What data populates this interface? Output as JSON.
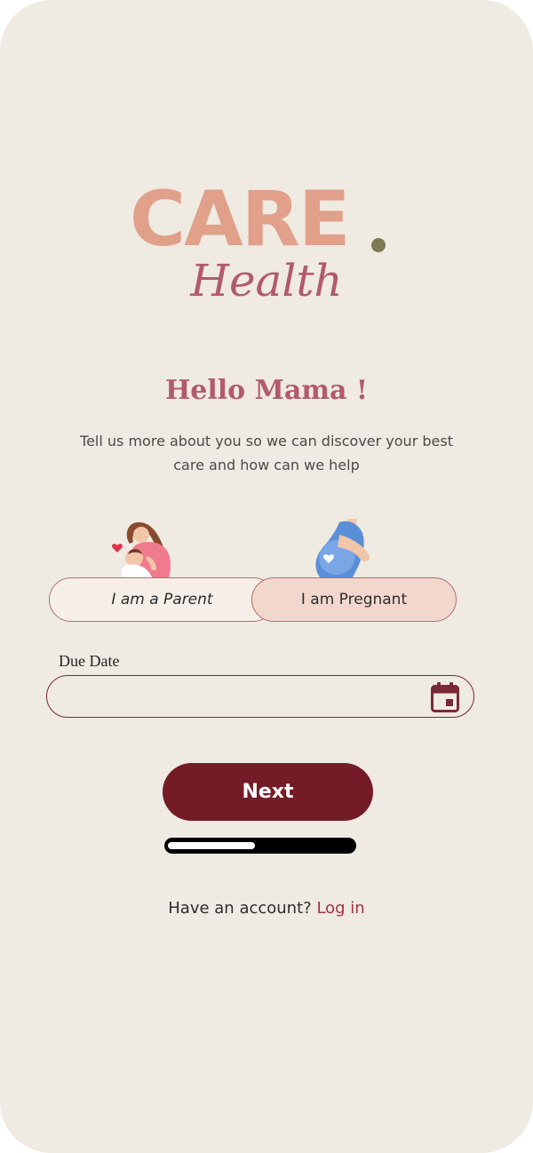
{
  "brand": {
    "logo_word": "CARE",
    "logo_subword": "Health",
    "logo_color": "#e0a08a",
    "dot_color": "#7d7a55",
    "health_color": "#b25a6c"
  },
  "onboarding": {
    "greeting": "Hello Mama !",
    "greeting_color": "#b25a6c",
    "subtitle": "Tell us more about you so we can discover your best care and how can we help",
    "illustrations": [
      "mother-with-baby-illustration",
      "pregnant-woman-illustration"
    ],
    "role_options": [
      {
        "label": "I am a Parent",
        "selected": false
      },
      {
        "label": "I am Pregnant",
        "selected": true
      }
    ],
    "due_date": {
      "label": "Due Date",
      "value": "",
      "icon": "calendar-icon",
      "icon_color": "#7a2a36"
    },
    "next_button": {
      "label": "Next",
      "bg_color": "#741b28"
    },
    "progress": {
      "fraction": 0.47
    },
    "footer": {
      "prompt": "Have an account?",
      "link": "Log in",
      "link_color": "#a23544"
    }
  }
}
